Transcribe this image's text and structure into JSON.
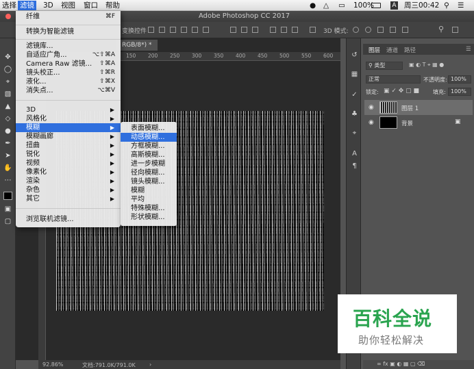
{
  "menubar": {
    "items": [
      "选择",
      "滤镜",
      "3D",
      "视图",
      "窗口",
      "帮助"
    ],
    "status": {
      "battery": "100%",
      "clock": "周三00:42",
      "app_badge": "A"
    }
  },
  "window": {
    "title": "Adobe Photoshop CC 2017"
  },
  "options_bar": {
    "transform_label": "变换控件",
    "mode_label": "3D 模式:"
  },
  "document": {
    "tab_label": "RGB/8*) *",
    "ruler_ticks": [
      "150",
      "200",
      "250",
      "300",
      "350",
      "400",
      "450",
      "500",
      "550",
      "600"
    ],
    "zoom": "92.86%",
    "doc_size": "文档:791.0K/791.0K"
  },
  "filter_menu": {
    "top": [
      {
        "label": "纤维",
        "shortcut": "⌘F"
      }
    ],
    "group1": [
      {
        "label": "转换为智能滤镜"
      }
    ],
    "group2": [
      {
        "label": "滤镜库..."
      },
      {
        "label": "自适应广角...",
        "shortcut": "⌥⇧⌘A"
      },
      {
        "label": "Camera Raw 滤镜...",
        "shortcut": "⇧⌘A"
      },
      {
        "label": "镜头校正...",
        "shortcut": "⇧⌘R"
      },
      {
        "label": "液化...",
        "shortcut": "⇧⌘X"
      },
      {
        "label": "消失点...",
        "shortcut": "⌥⌘V"
      }
    ],
    "group3": [
      {
        "label": "3D"
      },
      {
        "label": "风格化"
      },
      {
        "label": "模糊"
      },
      {
        "label": "模糊画廊"
      },
      {
        "label": "扭曲"
      },
      {
        "label": "锐化"
      },
      {
        "label": "视频"
      },
      {
        "label": "像素化"
      },
      {
        "label": "渲染"
      },
      {
        "label": "杂色"
      },
      {
        "label": "其它"
      }
    ],
    "group4": [
      {
        "label": "浏览联机滤镜..."
      }
    ]
  },
  "blur_submenu": {
    "items": [
      "表面模糊...",
      "动感模糊...",
      "方框模糊...",
      "高斯模糊...",
      "进一步模糊",
      "径向模糊...",
      "镜头模糊...",
      "模糊",
      "平均",
      "特殊模糊...",
      "形状模糊..."
    ]
  },
  "layers_panel": {
    "tabs": [
      "图层",
      "通道",
      "路径"
    ],
    "filter_kind": "类型",
    "blend_mode": "正常",
    "opacity_label": "不透明度:",
    "opacity": "100%",
    "lock_label": "锁定:",
    "fill_label": "填充:",
    "fill": "100%",
    "layers": [
      {
        "name": "图层 1",
        "selected": true
      },
      {
        "name": "背景",
        "selected": false
      }
    ]
  },
  "watermark": {
    "title": "百科全说",
    "subtitle": "助你轻松解决"
  },
  "colors": {
    "menu_highlight": "#2f6fde",
    "watermark_green": "#2aa44f"
  }
}
